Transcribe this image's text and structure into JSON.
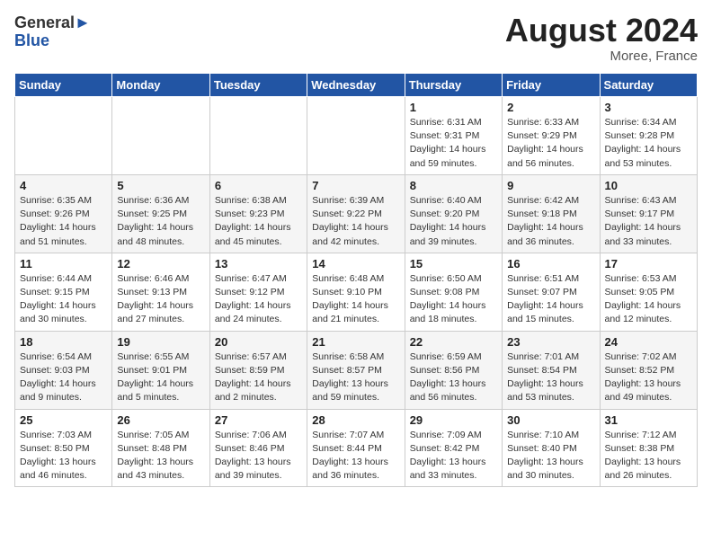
{
  "header": {
    "logo_line1": "General",
    "logo_line2": "Blue",
    "month_year": "August 2024",
    "location": "Moree, France"
  },
  "days_of_week": [
    "Sunday",
    "Monday",
    "Tuesday",
    "Wednesday",
    "Thursday",
    "Friday",
    "Saturday"
  ],
  "weeks": [
    [
      {
        "day": "",
        "info": ""
      },
      {
        "day": "",
        "info": ""
      },
      {
        "day": "",
        "info": ""
      },
      {
        "day": "",
        "info": ""
      },
      {
        "day": "1",
        "info": "Sunrise: 6:31 AM\nSunset: 9:31 PM\nDaylight: 14 hours\nand 59 minutes."
      },
      {
        "day": "2",
        "info": "Sunrise: 6:33 AM\nSunset: 9:29 PM\nDaylight: 14 hours\nand 56 minutes."
      },
      {
        "day": "3",
        "info": "Sunrise: 6:34 AM\nSunset: 9:28 PM\nDaylight: 14 hours\nand 53 minutes."
      }
    ],
    [
      {
        "day": "4",
        "info": "Sunrise: 6:35 AM\nSunset: 9:26 PM\nDaylight: 14 hours\nand 51 minutes."
      },
      {
        "day": "5",
        "info": "Sunrise: 6:36 AM\nSunset: 9:25 PM\nDaylight: 14 hours\nand 48 minutes."
      },
      {
        "day": "6",
        "info": "Sunrise: 6:38 AM\nSunset: 9:23 PM\nDaylight: 14 hours\nand 45 minutes."
      },
      {
        "day": "7",
        "info": "Sunrise: 6:39 AM\nSunset: 9:22 PM\nDaylight: 14 hours\nand 42 minutes."
      },
      {
        "day": "8",
        "info": "Sunrise: 6:40 AM\nSunset: 9:20 PM\nDaylight: 14 hours\nand 39 minutes."
      },
      {
        "day": "9",
        "info": "Sunrise: 6:42 AM\nSunset: 9:18 PM\nDaylight: 14 hours\nand 36 minutes."
      },
      {
        "day": "10",
        "info": "Sunrise: 6:43 AM\nSunset: 9:17 PM\nDaylight: 14 hours\nand 33 minutes."
      }
    ],
    [
      {
        "day": "11",
        "info": "Sunrise: 6:44 AM\nSunset: 9:15 PM\nDaylight: 14 hours\nand 30 minutes."
      },
      {
        "day": "12",
        "info": "Sunrise: 6:46 AM\nSunset: 9:13 PM\nDaylight: 14 hours\nand 27 minutes."
      },
      {
        "day": "13",
        "info": "Sunrise: 6:47 AM\nSunset: 9:12 PM\nDaylight: 14 hours\nand 24 minutes."
      },
      {
        "day": "14",
        "info": "Sunrise: 6:48 AM\nSunset: 9:10 PM\nDaylight: 14 hours\nand 21 minutes."
      },
      {
        "day": "15",
        "info": "Sunrise: 6:50 AM\nSunset: 9:08 PM\nDaylight: 14 hours\nand 18 minutes."
      },
      {
        "day": "16",
        "info": "Sunrise: 6:51 AM\nSunset: 9:07 PM\nDaylight: 14 hours\nand 15 minutes."
      },
      {
        "day": "17",
        "info": "Sunrise: 6:53 AM\nSunset: 9:05 PM\nDaylight: 14 hours\nand 12 minutes."
      }
    ],
    [
      {
        "day": "18",
        "info": "Sunrise: 6:54 AM\nSunset: 9:03 PM\nDaylight: 14 hours\nand 9 minutes."
      },
      {
        "day": "19",
        "info": "Sunrise: 6:55 AM\nSunset: 9:01 PM\nDaylight: 14 hours\nand 5 minutes."
      },
      {
        "day": "20",
        "info": "Sunrise: 6:57 AM\nSunset: 8:59 PM\nDaylight: 14 hours\nand 2 minutes."
      },
      {
        "day": "21",
        "info": "Sunrise: 6:58 AM\nSunset: 8:57 PM\nDaylight: 13 hours\nand 59 minutes."
      },
      {
        "day": "22",
        "info": "Sunrise: 6:59 AM\nSunset: 8:56 PM\nDaylight: 13 hours\nand 56 minutes."
      },
      {
        "day": "23",
        "info": "Sunrise: 7:01 AM\nSunset: 8:54 PM\nDaylight: 13 hours\nand 53 minutes."
      },
      {
        "day": "24",
        "info": "Sunrise: 7:02 AM\nSunset: 8:52 PM\nDaylight: 13 hours\nand 49 minutes."
      }
    ],
    [
      {
        "day": "25",
        "info": "Sunrise: 7:03 AM\nSunset: 8:50 PM\nDaylight: 13 hours\nand 46 minutes."
      },
      {
        "day": "26",
        "info": "Sunrise: 7:05 AM\nSunset: 8:48 PM\nDaylight: 13 hours\nand 43 minutes."
      },
      {
        "day": "27",
        "info": "Sunrise: 7:06 AM\nSunset: 8:46 PM\nDaylight: 13 hours\nand 39 minutes."
      },
      {
        "day": "28",
        "info": "Sunrise: 7:07 AM\nSunset: 8:44 PM\nDaylight: 13 hours\nand 36 minutes."
      },
      {
        "day": "29",
        "info": "Sunrise: 7:09 AM\nSunset: 8:42 PM\nDaylight: 13 hours\nand 33 minutes."
      },
      {
        "day": "30",
        "info": "Sunrise: 7:10 AM\nSunset: 8:40 PM\nDaylight: 13 hours\nand 30 minutes."
      },
      {
        "day": "31",
        "info": "Sunrise: 7:12 AM\nSunset: 8:38 PM\nDaylight: 13 hours\nand 26 minutes."
      }
    ]
  ]
}
